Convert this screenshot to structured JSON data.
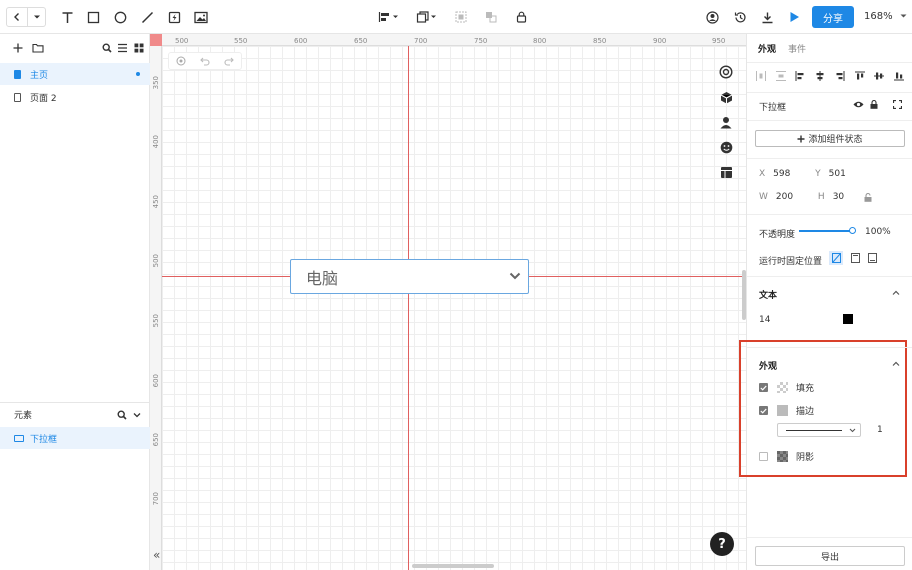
{
  "toolbar": {
    "share_label": "分享",
    "zoom_label": "168%",
    "icons": [
      "back-icon",
      "dropdown-caret-icon",
      "text-tool-icon",
      "rectangle-tool-icon",
      "circle-tool-icon",
      "line-tool-icon",
      "flash-icon",
      "image-tool-icon",
      "align-icon",
      "arrange-icon",
      "group-icon",
      "ungroup-icon",
      "lock-icon",
      "user-icon",
      "history-icon",
      "download-icon",
      "play-icon"
    ]
  },
  "left_panel": {
    "pages": [
      {
        "label": "主页",
        "active": true
      },
      {
        "label": "页面 2",
        "active": false
      }
    ],
    "elements_title": "元素",
    "elements": [
      {
        "label": "下拉框"
      }
    ]
  },
  "canvas": {
    "ruler_top": [
      "500",
      "550",
      "600",
      "650",
      "700",
      "750",
      "800",
      "850",
      "900",
      "950"
    ],
    "ruler_left": [
      "350",
      "400",
      "450",
      "500",
      "550",
      "600",
      "650",
      "700"
    ],
    "dropdown_value": "电脑",
    "help_label": "?",
    "collapse_label": "«"
  },
  "right_panel": {
    "tabs": [
      {
        "label": "外观",
        "active": true
      },
      {
        "label": "事件",
        "active": false
      }
    ],
    "component_name": "下拉框",
    "add_state_label": "添加组件状态",
    "position": {
      "x_label": "X",
      "x": "598",
      "y_label": "Y",
      "y": "501"
    },
    "size": {
      "w_label": "W",
      "w": "200",
      "h_label": "H",
      "h": "30"
    },
    "opacity_label": "不透明度",
    "opacity_value": "100%",
    "opacity": 1.0,
    "fixed_label": "运行时固定位置",
    "text_section": "文本",
    "font_size": "14",
    "text_color": "#000000",
    "appearance_section": "外观",
    "fill_label": "填充",
    "stroke_label": "描边",
    "stroke_width": "1",
    "shadow_label": "阴影",
    "export_label": "导出"
  },
  "colors": {
    "accent": "#1e88e5",
    "guide": "#e06060",
    "highlight": "#d9402b"
  }
}
